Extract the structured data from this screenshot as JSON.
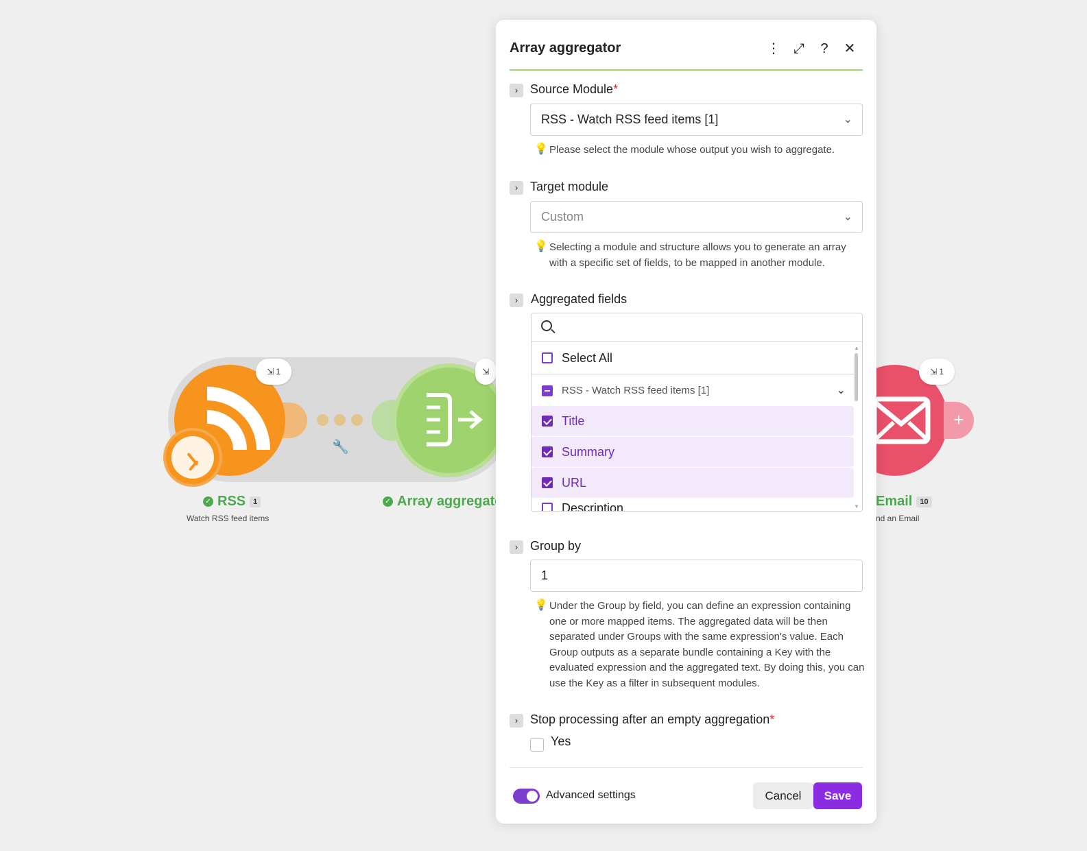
{
  "canvas": {
    "modules": [
      {
        "id": "rss",
        "title": "RSS",
        "count": "1",
        "subtitle": "Watch RSS feed items",
        "ops_badge": "⇲ 1"
      },
      {
        "id": "array-aggregator",
        "title": "Array aggregato",
        "ops_badge": "⇲"
      },
      {
        "id": "email",
        "title": "Email",
        "count": "10",
        "subtitle": "nd an Email",
        "ops_badge": "⇲ 1"
      }
    ],
    "colors": {
      "rss": "#f7941d",
      "aggregator": "#9fd36d",
      "email": "#e9506a",
      "success": "#4ea84f"
    }
  },
  "dialog": {
    "title": "Array aggregator",
    "header_icons": [
      "more-vertical-icon",
      "expand-icon",
      "help-icon",
      "close-icon"
    ],
    "header_glyphs": {
      "more": "⋮",
      "expand": "⤢",
      "help": "?",
      "close": "✕"
    },
    "source_module": {
      "label": "Source Module",
      "required_mark": "*",
      "value": "RSS - Watch RSS feed items [1]",
      "hint": "Please select the module whose output you wish to aggregate."
    },
    "target_module": {
      "label": "Target module",
      "value": "Custom",
      "hint": "Selecting a module and structure allows you to generate an array with a specific set of fields, to be mapped in another module."
    },
    "aggregated_fields": {
      "label": "Aggregated fields",
      "search_placeholder": "",
      "select_all": "Select All",
      "group": "RSS - Watch RSS feed items [1]",
      "options": [
        {
          "label": "Title",
          "checked": true
        },
        {
          "label": "Summary",
          "checked": true
        },
        {
          "label": "URL",
          "checked": true
        },
        {
          "label": "Description",
          "checked": false
        }
      ]
    },
    "group_by": {
      "label": "Group by",
      "value": "1",
      "hint": "Under the Group by field, you can define an expression containing one or more mapped items. The aggregated data will be then separated under Groups with the same expression's value. Each Group outputs as a separate bundle containing a Key with the evaluated expression and the aggregated text. By doing this, you can use the Key as a filter in subsequent modules."
    },
    "stop_processing": {
      "label": "Stop processing after an empty aggregation",
      "required_mark": "*",
      "option": "Yes",
      "checked": false
    },
    "footer": {
      "advanced_settings": "Advanced settings",
      "advanced_enabled": true,
      "cancel": "Cancel",
      "save": "Save"
    },
    "accent_color": "#8b2be2"
  }
}
